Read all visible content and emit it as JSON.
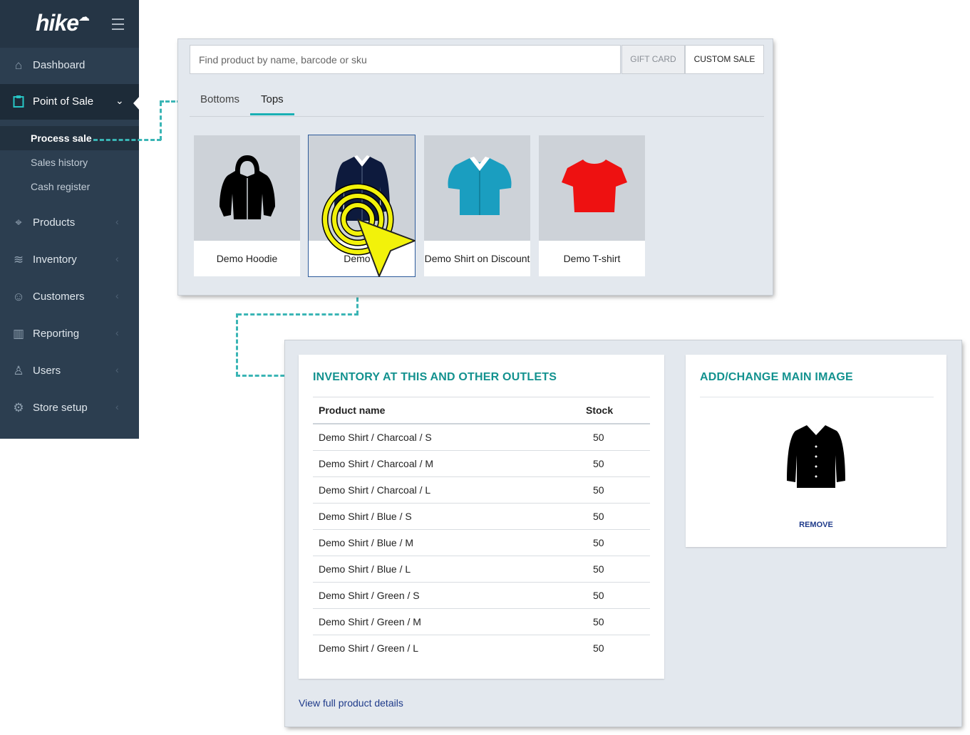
{
  "app": {
    "logo": "hike"
  },
  "sidebar": {
    "items": [
      {
        "label": "Dashboard",
        "icon": "home-icon"
      },
      {
        "label": "Point of Sale",
        "icon": "clipboard-icon",
        "active": true
      },
      {
        "label": "Products",
        "icon": "tag-icon"
      },
      {
        "label": "Inventory",
        "icon": "layers-icon"
      },
      {
        "label": "Customers",
        "icon": "customers-icon"
      },
      {
        "label": "Reporting",
        "icon": "bar-chart-icon"
      },
      {
        "label": "Users",
        "icon": "user-icon"
      },
      {
        "label": "Store setup",
        "icon": "gear-icon"
      }
    ],
    "subitems": [
      {
        "label": "Process sale",
        "active": true
      },
      {
        "label": "Sales history"
      },
      {
        "label": "Cash register"
      }
    ]
  },
  "pos": {
    "search_placeholder": "Find product by name, barcode or sku",
    "gift_card_label": "GIFT CARD",
    "custom_sale_label": "CUSTOM SALE",
    "tabs": [
      {
        "label": "Bottoms"
      },
      {
        "label": "Tops",
        "active": true
      }
    ],
    "products": [
      {
        "name": "Demo Hoodie",
        "icon": "hoodie-icon",
        "color": "#000000"
      },
      {
        "name": "Demo S",
        "icon": "shirt-icon",
        "color": "#0d1a3d",
        "selected": true
      },
      {
        "name": "Demo Shirt on Discount",
        "icon": "shirt-icon",
        "color": "#1a9ec0"
      },
      {
        "name": "Demo T-shirt",
        "icon": "tshirt-icon",
        "color": "#ee1111"
      }
    ]
  },
  "inventory": {
    "title": "INVENTORY AT THIS AND OTHER OUTLETS",
    "columns": [
      "Product name",
      "Stock"
    ],
    "rows": [
      [
        "Demo Shirt / Charcoal / S",
        "50"
      ],
      [
        "Demo Shirt / Charcoal / M",
        "50"
      ],
      [
        "Demo Shirt / Charcoal / L",
        "50"
      ],
      [
        "Demo Shirt / Blue / S",
        "50"
      ],
      [
        "Demo Shirt / Blue / M",
        "50"
      ],
      [
        "Demo Shirt / Blue / L",
        "50"
      ],
      [
        "Demo Shirt / Green / S",
        "50"
      ],
      [
        "Demo Shirt / Green / M",
        "50"
      ],
      [
        "Demo Shirt / Green / L",
        "50"
      ]
    ],
    "view_link": "View full product details"
  },
  "image_card": {
    "title": "ADD/CHANGE MAIN IMAGE",
    "remove_label": "REMOVE"
  },
  "colors": {
    "accent": "#1ab0b4",
    "sidebar_bg": "#2c3e50",
    "title_teal": "#13928f",
    "link_blue": "#1e3a8a",
    "cursor_yellow": "#f2f20a"
  }
}
